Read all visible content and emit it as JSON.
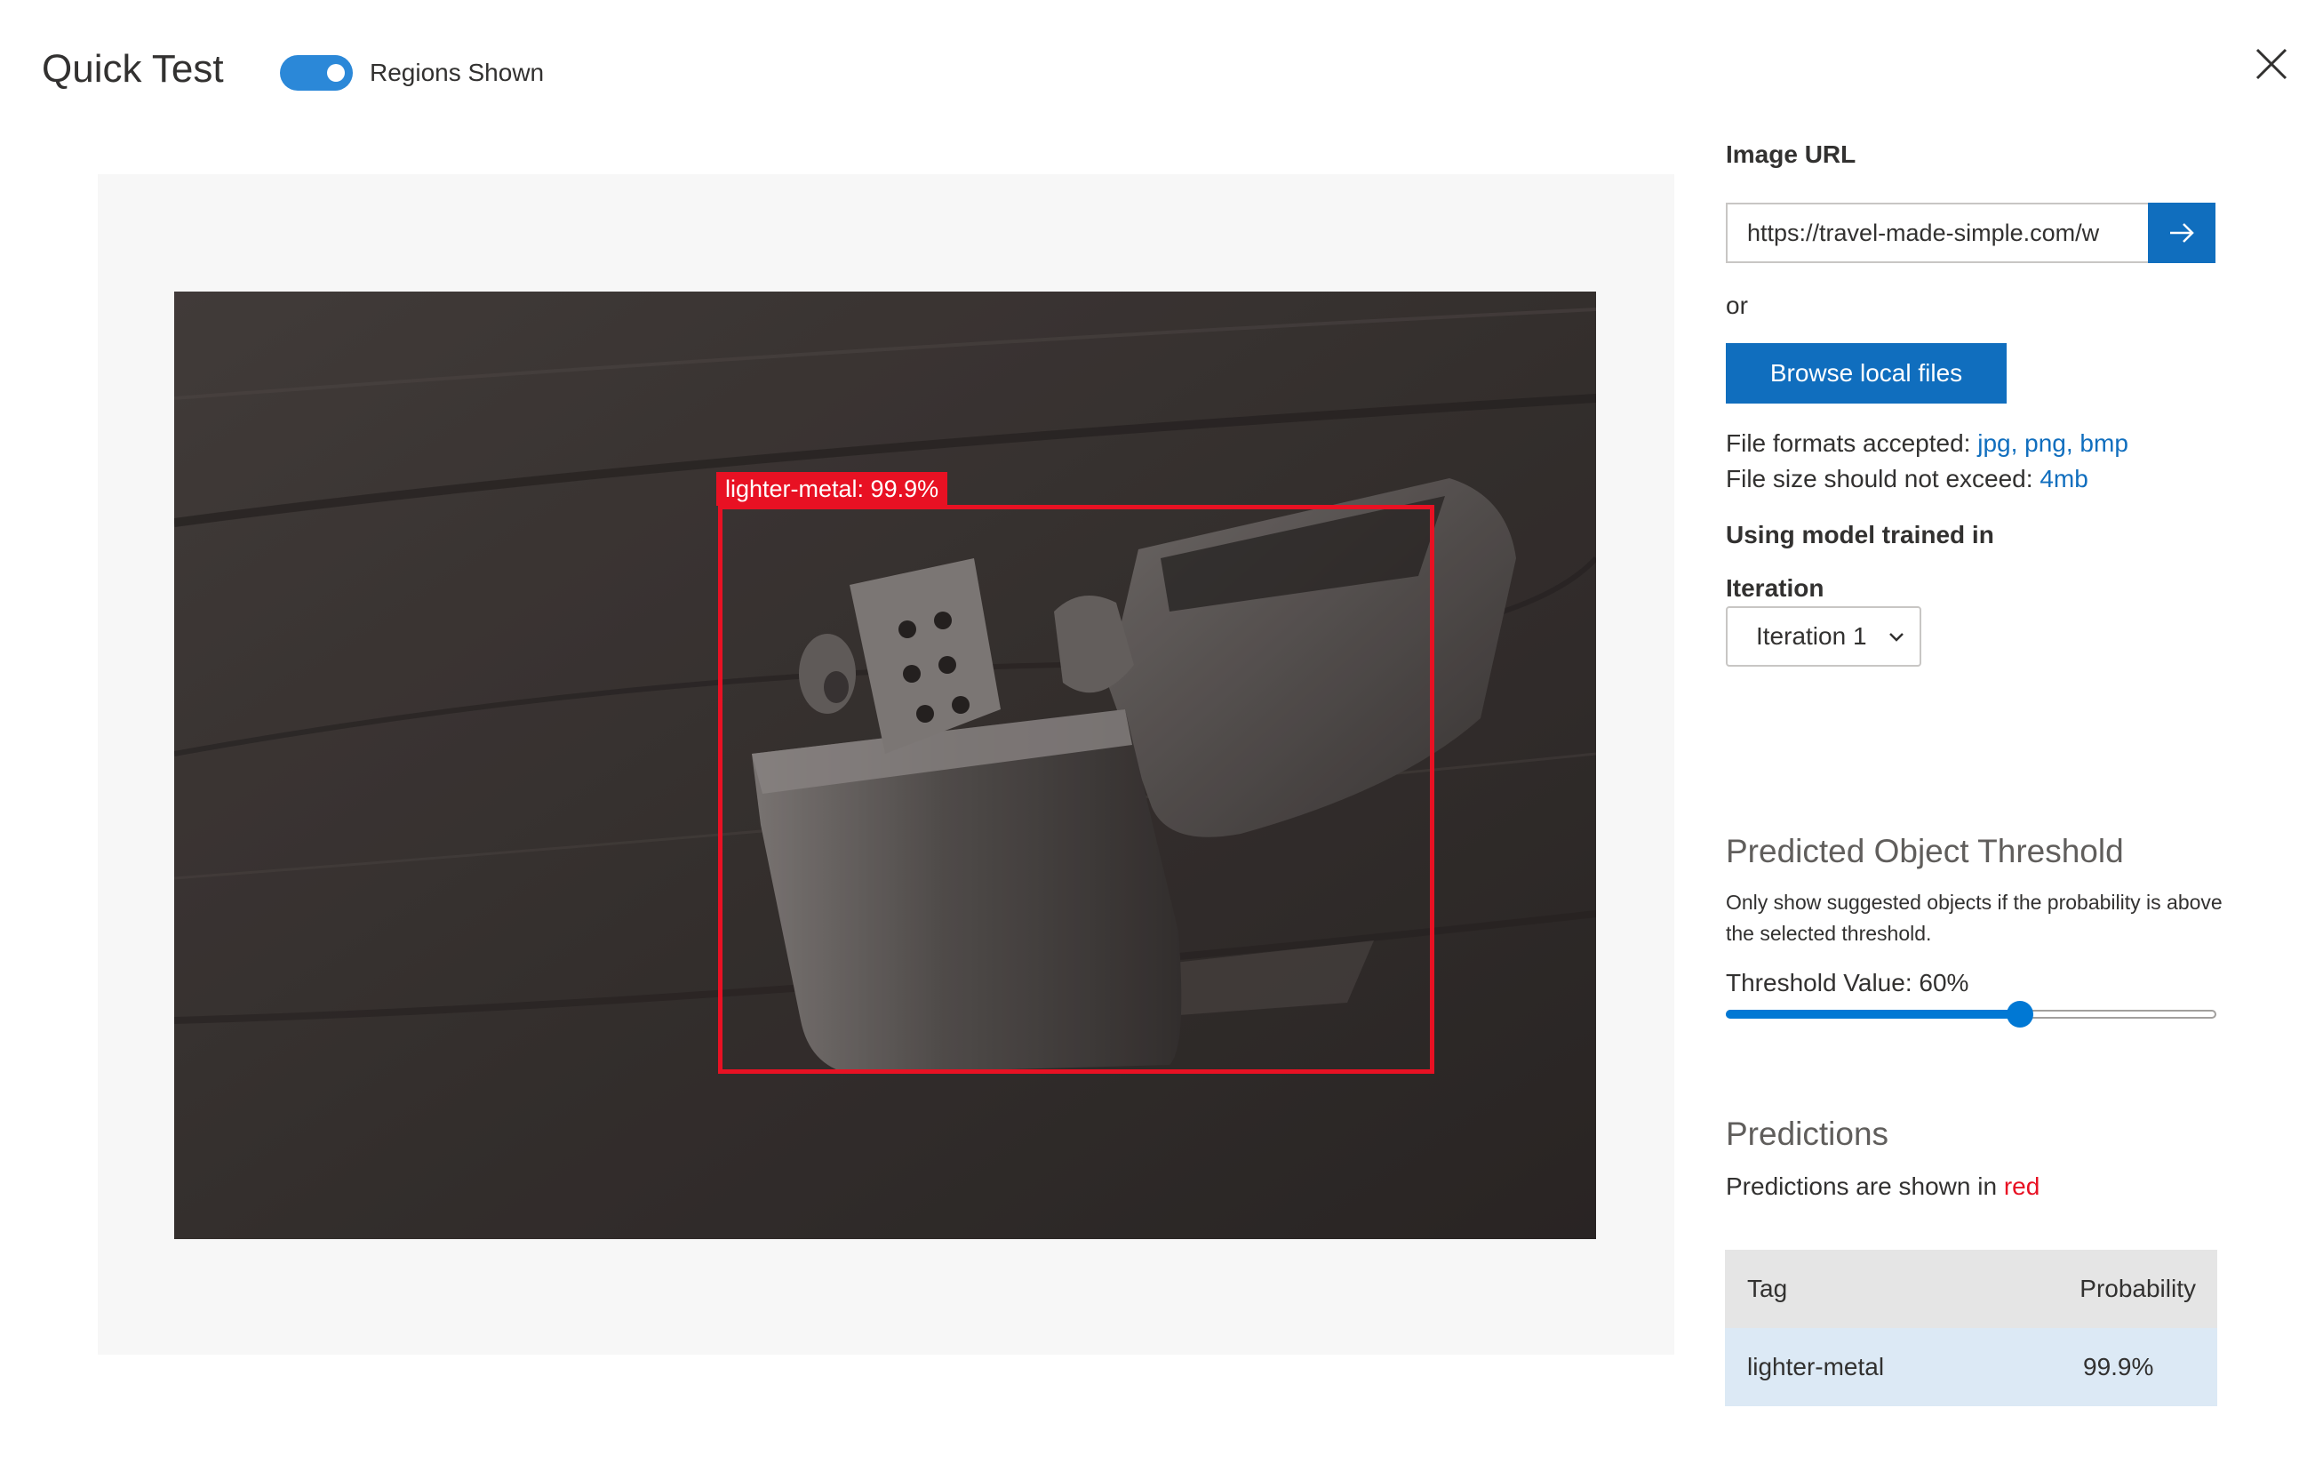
{
  "header": {
    "title": "Quick Test",
    "toggle_label": "Regions Shown",
    "toggle_on": true
  },
  "icons": {
    "close": "close-icon",
    "submit": "arrow-right-icon",
    "dropdown": "chevron-down-icon"
  },
  "image_panel": {
    "prediction_label": "lighter-metal: 99.9%",
    "box_color": "#e81123"
  },
  "image_url": {
    "label": "Image URL",
    "value": "https://travel-made-simple.com/w"
  },
  "or_text": "or",
  "browse_button": "Browse local files",
  "file_info": {
    "formats_prefix": "File formats accepted: ",
    "formats": "jpg, png, bmp",
    "size_prefix": "File size should not exceed: ",
    "size": "4mb"
  },
  "model": {
    "label": "Using model trained in",
    "iteration_label": "Iteration",
    "iteration_selected": "Iteration 1"
  },
  "threshold": {
    "title": "Predicted Object Threshold",
    "description": "Only show suggested objects if the probability is above the selected threshold.",
    "value_text": "Threshold Value: 60%",
    "value_fraction": 0.6
  },
  "predictions": {
    "title": "Predictions",
    "note_prefix": "Predictions are shown in ",
    "note_color_word": "red",
    "columns": [
      "Tag",
      "Probability"
    ],
    "rows": [
      {
        "tag": "lighter-metal",
        "probability": "99.9%"
      }
    ]
  },
  "colors": {
    "accent": "#106ebe",
    "toggle": "#2b88d8",
    "prediction": "#e81123"
  }
}
